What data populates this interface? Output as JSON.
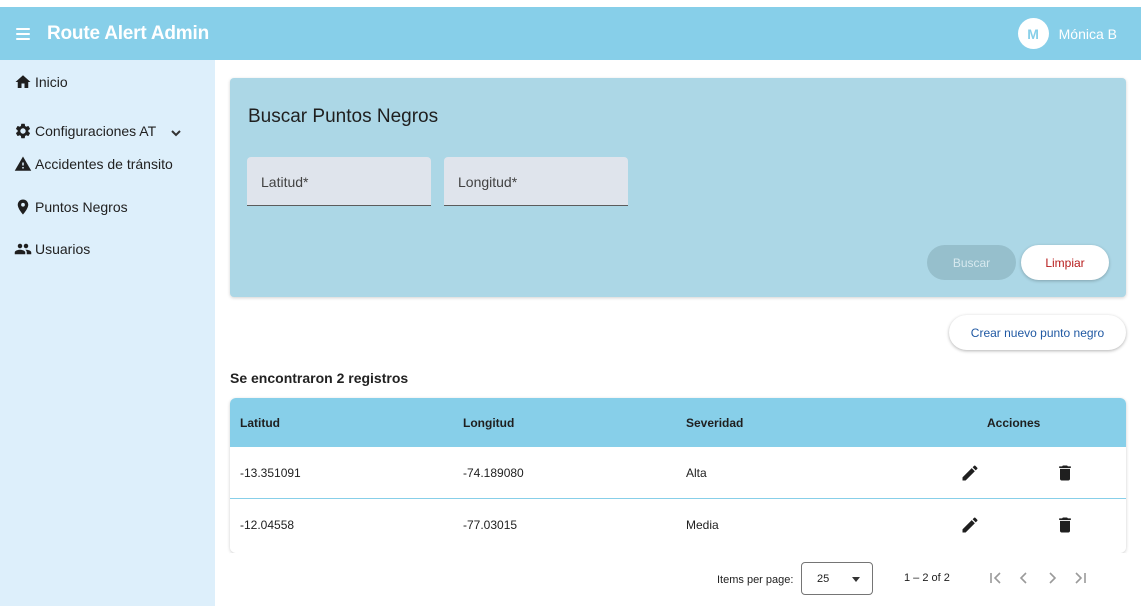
{
  "header": {
    "title": "Route Alert Admin",
    "avatar_initial": "M",
    "user_name": "Mónica B"
  },
  "sidebar": {
    "items": [
      {
        "label": "Inicio",
        "icon": "home-icon"
      },
      {
        "label": "Configuraciones AT",
        "icon": "gear-icon",
        "expanded": true
      },
      {
        "label": "Accidentes de tránsito",
        "icon": "warning-icon"
      },
      {
        "label": "Puntos Negros",
        "icon": "map-pin-icon"
      },
      {
        "label": "Usuarios",
        "icon": "users-icon"
      }
    ]
  },
  "search": {
    "title": "Buscar Puntos Negros",
    "lat_placeholder": "Latitud*",
    "lng_placeholder": "Longitud*",
    "search_label": "Buscar",
    "clear_label": "Limpiar"
  },
  "create_label": "Crear nuevo punto negro",
  "result_count": "Se encontraron 2 registros",
  "table": {
    "headers": [
      "Latitud",
      "Longitud",
      "Severidad",
      "Acciones"
    ],
    "rows": [
      {
        "lat": "-13.351091",
        "lng": "-74.189080",
        "severity": "Alta"
      },
      {
        "lat": "-12.04558",
        "lng": "-77.03015",
        "severity": "Media"
      }
    ]
  },
  "paginator": {
    "items_label": "Items per page:",
    "page_size": "25",
    "range": "1 – 2 of 2"
  },
  "colors": {
    "primary": "#87cfe9",
    "sidebar": "#ddeffb",
    "search_card": "#acd7e6",
    "danger_text": "#b71c1c",
    "link_text": "#2059a3"
  }
}
